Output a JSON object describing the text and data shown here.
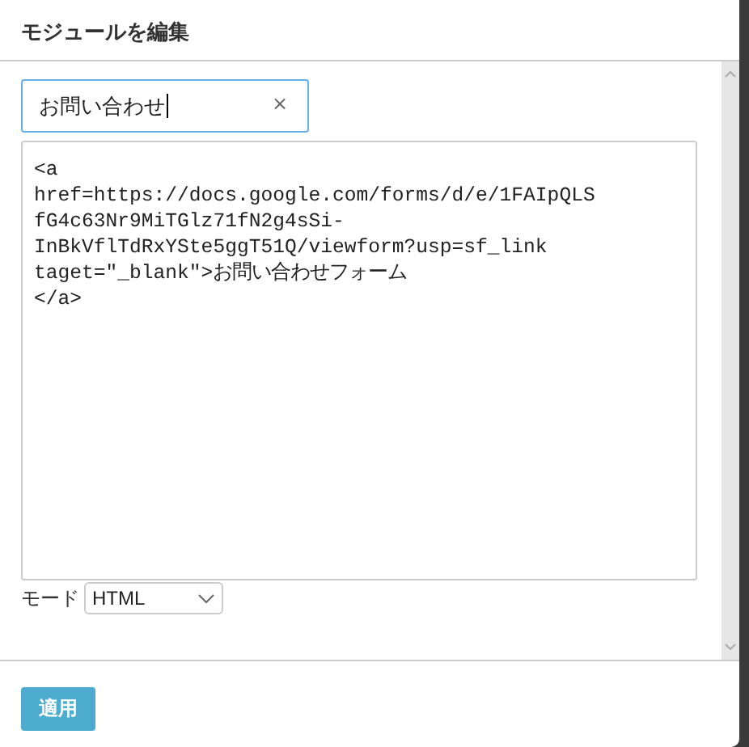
{
  "dialog": {
    "title": "モジュールを編集"
  },
  "name_field": {
    "value": "お問い合わせ",
    "clear": "×"
  },
  "code_editor": {
    "lines": [
      "<a",
      "href=https://docs.google.com/forms/d/e/1FAIpQLS",
      "fG4c63Nr9MiTGlz71fN2g4sSi-",
      "InBkVflTdRxYSte5ggT51Q/viewform?usp=sf_link",
      "taget=\"_blank\">お問い合わせフォーム",
      "</a>"
    ]
  },
  "mode": {
    "label": "モード",
    "value": "HTML"
  },
  "buttons": [
    "適用"
  ]
}
